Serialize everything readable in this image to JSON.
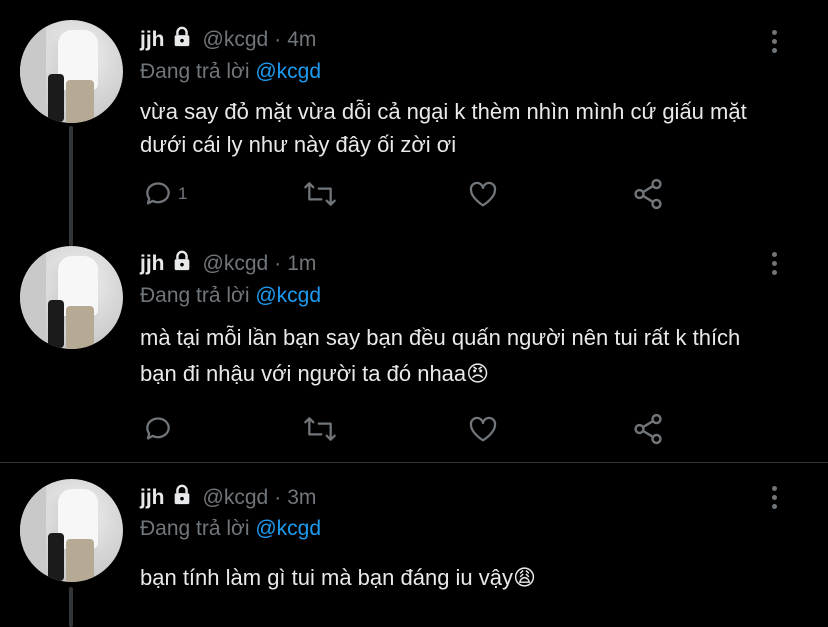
{
  "tweets": [
    {
      "name": "jjh",
      "handle": "@kcgd",
      "separator": "·",
      "time": "4m",
      "replying_prefix": "Đang trả lời",
      "replying_to": "@kcgd",
      "text": "vừa say đỏ mặt vừa dỗi cả ngại k thèm nhìn mình cứ giấu mặt dưới cái ly như này đây ối zời ơi",
      "reply_count": "1"
    },
    {
      "name": "jjh",
      "handle": "@kcgd",
      "separator": "·",
      "time": "1m",
      "replying_prefix": "Đang trả lời",
      "replying_to": "@kcgd",
      "text": "mà tại mỗi lần bạn say bạn đều quấn người nên tui rất k thích bạn đi nhậu với người ta đó nhaa😠",
      "reply_count": ""
    },
    {
      "name": "jjh",
      "handle": "@kcgd",
      "separator": "·",
      "time": "3m",
      "replying_prefix": "Đang trả lời",
      "replying_to": "@kcgd",
      "text": "bạn tính làm gì tui mà bạn đáng iu vậy😩",
      "reply_count": ""
    }
  ],
  "icons": {
    "more": "more-vertical-icon",
    "lock": "lock-icon",
    "reply": "reply-icon",
    "retweet": "retweet-icon",
    "like": "heart-icon",
    "share": "share-icon"
  },
  "colors": {
    "background": "#000000",
    "text": "#e7e9ea",
    "secondary": "#71767b",
    "mention": "#1d9bf0",
    "divider": "#2f3336"
  }
}
